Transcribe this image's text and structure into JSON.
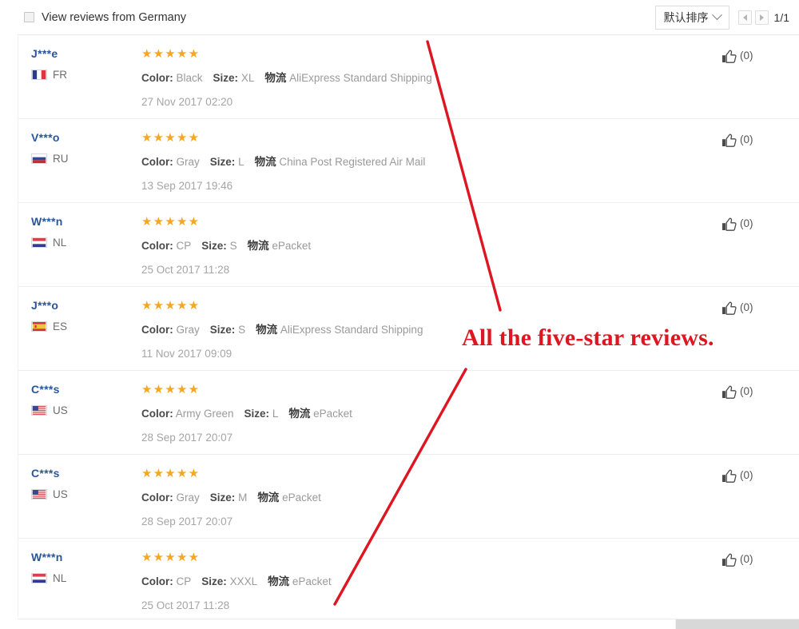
{
  "header": {
    "filter_label": "View reviews from Germany",
    "filter_checked": false,
    "sort_label": "默认排序",
    "sort_icon": "chevron-down-icon",
    "prev_icon": "triangle-left-icon",
    "next_icon": "triangle-right-icon",
    "page_indicator": "1/1"
  },
  "reviews": [
    {
      "user": "J***e",
      "country_code": "FR",
      "flag": "france-flag-icon",
      "stars": "★★★★★",
      "rating": 5,
      "color_key": "Color:",
      "color_value": "Black",
      "size_key": "Size:",
      "size_value": "XL",
      "logistics_key": "物流",
      "logistics_value": "AliExpress Standard Shipping",
      "date": "27 Nov 2017 02:20",
      "like_count": "(0)",
      "like_icon": "thumbs-up-icon"
    },
    {
      "user": "V***o",
      "country_code": "RU",
      "flag": "russia-flag-icon",
      "stars": "★★★★★",
      "rating": 5,
      "color_key": "Color:",
      "color_value": "Gray",
      "size_key": "Size:",
      "size_value": "L",
      "logistics_key": "物流",
      "logistics_value": "China Post Registered Air Mail",
      "date": "13 Sep 2017 19:46",
      "like_count": "(0)",
      "like_icon": "thumbs-up-icon"
    },
    {
      "user": "W***n",
      "country_code": "NL",
      "flag": "netherlands-flag-icon",
      "stars": "★★★★★",
      "rating": 5,
      "color_key": "Color:",
      "color_value": "CP",
      "size_key": "Size:",
      "size_value": "S",
      "logistics_key": "物流",
      "logistics_value": "ePacket",
      "date": "25 Oct 2017 11:28",
      "like_count": "(0)",
      "like_icon": "thumbs-up-icon"
    },
    {
      "user": "J***o",
      "country_code": "ES",
      "flag": "spain-flag-icon",
      "stars": "★★★★★",
      "rating": 5,
      "color_key": "Color:",
      "color_value": "Gray",
      "size_key": "Size:",
      "size_value": "S",
      "logistics_key": "物流",
      "logistics_value": "AliExpress Standard Shipping",
      "date": "11 Nov 2017 09:09",
      "like_count": "(0)",
      "like_icon": "thumbs-up-icon"
    },
    {
      "user": "C***s",
      "country_code": "US",
      "flag": "usa-flag-icon",
      "stars": "★★★★★",
      "rating": 5,
      "color_key": "Color:",
      "color_value": "Army Green",
      "size_key": "Size:",
      "size_value": "L",
      "logistics_key": "物流",
      "logistics_value": "ePacket",
      "date": "28 Sep 2017 20:07",
      "like_count": "(0)",
      "like_icon": "thumbs-up-icon"
    },
    {
      "user": "C***s",
      "country_code": "US",
      "flag": "usa-flag-icon",
      "stars": "★★★★★",
      "rating": 5,
      "color_key": "Color:",
      "color_value": "Gray",
      "size_key": "Size:",
      "size_value": "M",
      "logistics_key": "物流",
      "logistics_value": "ePacket",
      "date": "28 Sep 2017 20:07",
      "like_count": "(0)",
      "like_icon": "thumbs-up-icon"
    },
    {
      "user": "W***n",
      "country_code": "NL",
      "flag": "netherlands-flag-icon",
      "stars": "★★★★★",
      "rating": 5,
      "color_key": "Color:",
      "color_value": "CP",
      "size_key": "Size:",
      "size_value": "XXXL",
      "logistics_key": "物流",
      "logistics_value": "ePacket",
      "date": "25 Oct 2017 11:28",
      "like_count": "(0)",
      "like_icon": "thumbs-up-icon"
    }
  ],
  "annotation": {
    "text": "All the five-star reviews.",
    "color": "#dd1622"
  },
  "colors": {
    "star": "#f6a623",
    "username": "#2a5699",
    "annotation_red": "#dd1622",
    "muted_text": "#9a9a9a",
    "divider": "#eeeeee"
  }
}
